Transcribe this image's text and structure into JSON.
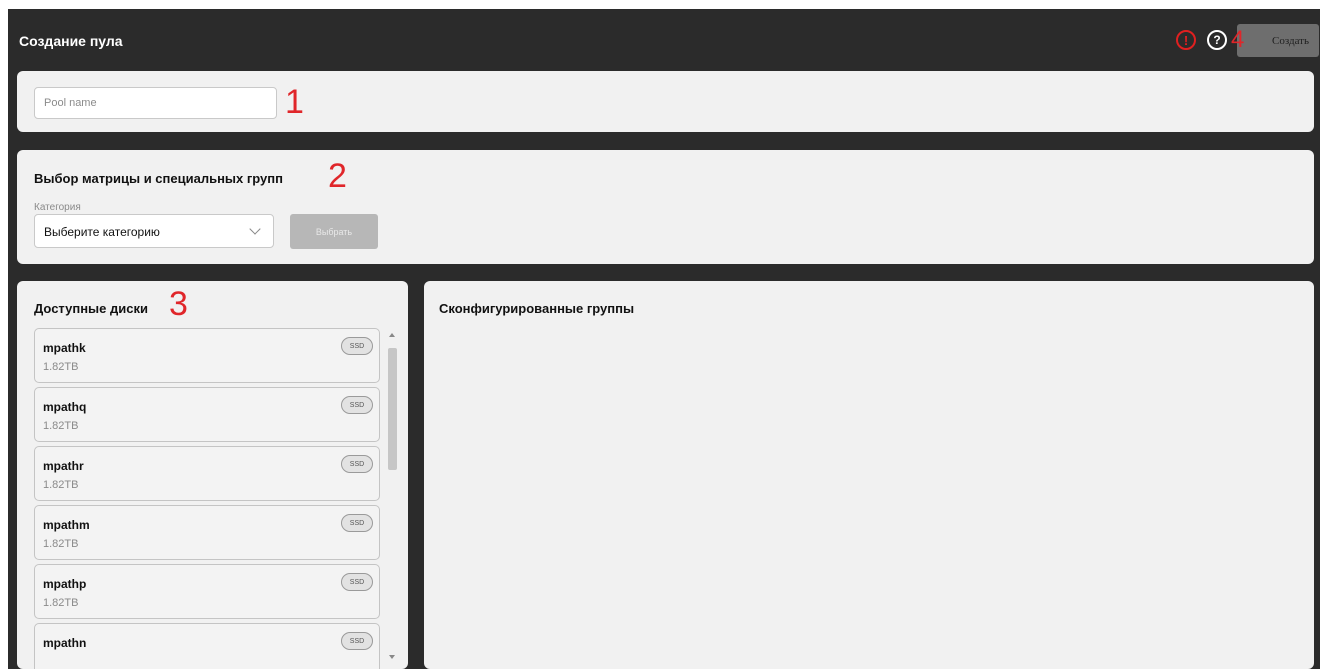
{
  "header": {
    "title": "Создание пула",
    "alert_icon": "!",
    "help_icon": "?",
    "create_label": "Создать"
  },
  "markers": {
    "m1": "1",
    "m2": "2",
    "m3": "3",
    "m4": "4"
  },
  "pool": {
    "placeholder": "Pool name",
    "value": ""
  },
  "matrix": {
    "title": "Выбор матрицы и специальных групп",
    "category_label": "Категория",
    "category_value": "Выберите категорию",
    "choose_label": "Выбрать"
  },
  "disks": {
    "title": "Доступные диски",
    "items": [
      {
        "name": "mpathk",
        "size": "1.82TB",
        "badge": "SSD"
      },
      {
        "name": "mpathq",
        "size": "1.82TB",
        "badge": "SSD"
      },
      {
        "name": "mpathr",
        "size": "1.82TB",
        "badge": "SSD"
      },
      {
        "name": "mpathm",
        "size": "1.82TB",
        "badge": "SSD"
      },
      {
        "name": "mpathp",
        "size": "1.82TB",
        "badge": "SSD"
      },
      {
        "name": "mpathn",
        "size": "",
        "badge": "SSD"
      }
    ]
  },
  "groups": {
    "title": "Сконфигурированные группы"
  },
  "colors": {
    "header_bg": "#2b2b2b",
    "card_bg": "#f1f1f1",
    "alert": "#e02020",
    "annotation": "#e0262a"
  }
}
